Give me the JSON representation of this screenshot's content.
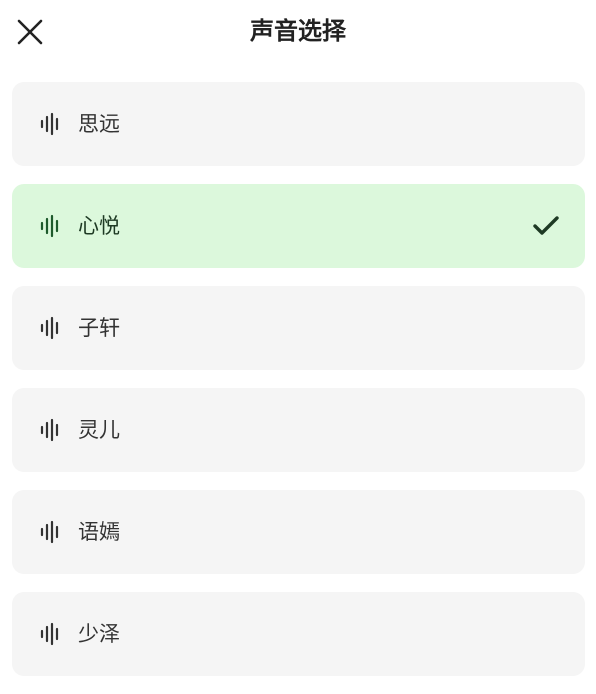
{
  "header": {
    "title": "声音选择",
    "close_icon": "close-icon"
  },
  "voices": [
    {
      "label": "思远",
      "icon": "sound-wave-icon",
      "selected": false
    },
    {
      "label": "心悦",
      "icon": "sound-wave-icon",
      "selected": true
    },
    {
      "label": "子轩",
      "icon": "sound-wave-icon",
      "selected": false
    },
    {
      "label": "灵儿",
      "icon": "sound-wave-icon",
      "selected": false
    },
    {
      "label": "语嫣",
      "icon": "sound-wave-icon",
      "selected": false
    },
    {
      "label": "少泽",
      "icon": "sound-wave-icon",
      "selected": false
    }
  ],
  "colors": {
    "selected_bg": "#dcf8dc",
    "item_bg": "#f5f5f5",
    "selected_icon": "#1e5a2c",
    "icon": "#333333"
  }
}
